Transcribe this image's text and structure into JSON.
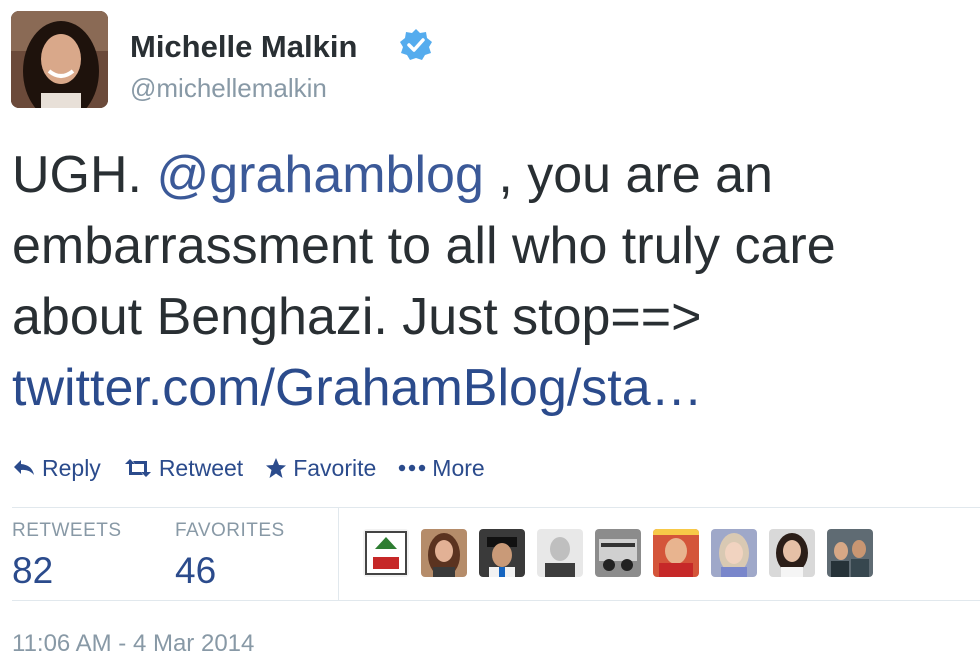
{
  "user": {
    "display_name": "Michelle Malkin",
    "handle": "@michellemalkin",
    "verified_icon": "verified-badge-icon"
  },
  "tweet": {
    "prefix": "UGH.",
    "mention": "@grahamblog",
    "line1_rest": ", you are an",
    "line2": "embarrassment to all who truly care",
    "line3": "about Benghazi. Just stop==>",
    "link": "twitter.com/GrahamBlog/sta…"
  },
  "actions": {
    "reply": "Reply",
    "retweet": "Retweet",
    "favorite": "Favorite",
    "more": "More"
  },
  "stats": {
    "retweets_label": "RETWEETS",
    "retweets_value": "82",
    "favorites_label": "FAVORITES",
    "favorites_value": "46"
  },
  "timestamp": "11:06 AM - 4 Mar 2014",
  "colors": {
    "link": "#2b4b8c",
    "verified": "#55acee",
    "muted": "#8899a6"
  }
}
